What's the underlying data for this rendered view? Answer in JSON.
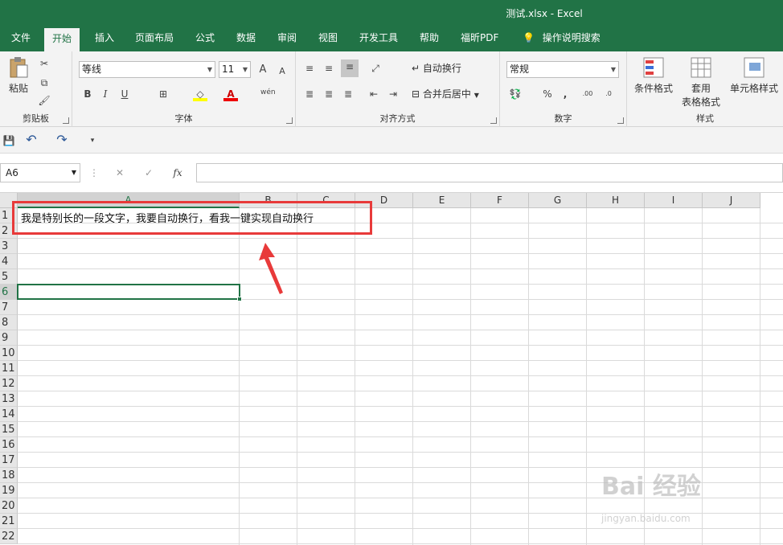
{
  "window": {
    "title": "测试.xlsx  -  Excel"
  },
  "tabs": [
    {
      "label": "文件"
    },
    {
      "label": "开始"
    },
    {
      "label": "插入"
    },
    {
      "label": "页面布局"
    },
    {
      "label": "公式"
    },
    {
      "label": "数据"
    },
    {
      "label": "审阅"
    },
    {
      "label": "视图"
    },
    {
      "label": "开发工具"
    },
    {
      "label": "帮助"
    },
    {
      "label": "福昕PDF"
    }
  ],
  "tell_me": "操作说明搜索",
  "ribbon": {
    "clipboard": {
      "paste": "粘贴",
      "label": "剪贴板"
    },
    "font": {
      "name": "等线",
      "size": "11",
      "label": "字体",
      "bold": "B",
      "italic": "I",
      "underline": "U",
      "grow": "A",
      "shrink": "A",
      "font_color": "A",
      "phonetic": "wén"
    },
    "alignment": {
      "wrap": "自动换行",
      "merge": "合并后居中",
      "label": "对齐方式"
    },
    "number": {
      "format": "常规",
      "percent": "%",
      "comma": ",",
      "inc_decimal": ".00",
      "dec_decimal": ".0",
      "label": "数字"
    },
    "styles": {
      "conditional": "条件格式",
      "table_line1": "套用",
      "table_line2": "表格格式",
      "cell_styles": "单元格样式",
      "label": "样式"
    }
  },
  "formula_bar": {
    "name_box": "A6",
    "fx": "fx",
    "content": ""
  },
  "sheet": {
    "columns": [
      "A",
      "B",
      "C",
      "D",
      "E",
      "F",
      "G",
      "H",
      "I",
      "J"
    ],
    "rows": [
      "1",
      "2",
      "3",
      "4",
      "5",
      "6",
      "7",
      "8",
      "9",
      "10",
      "11",
      "12",
      "13",
      "14",
      "15",
      "16",
      "17",
      "18",
      "19",
      "20",
      "21",
      "22"
    ],
    "a1_text": "我是特别长的一段文字，我要自动换行，看我一键实现自动换行",
    "selected_cell": "A6"
  },
  "watermark": {
    "brand": "Bai 经验",
    "url": "jingyan.baidu.com"
  },
  "colors": {
    "excel_green": "#217346",
    "annotation_red": "#e83a3a"
  }
}
